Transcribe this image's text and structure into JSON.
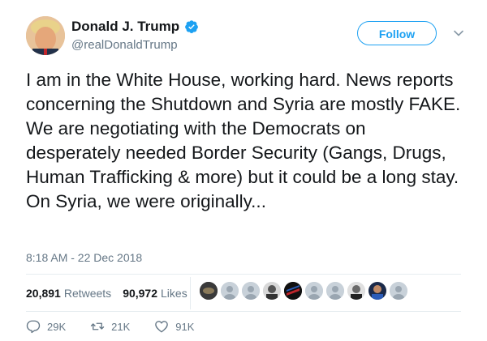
{
  "user": {
    "display_name": "Donald J. Trump",
    "handle": "@realDonaldTrump",
    "verified": true
  },
  "follow_label": "Follow",
  "tweet": {
    "text": "I am in the White House, working hard. News reports concerning the Shutdown and Syria are mostly FAKE. We are negotiating with the Democrats on desperately needed Border Security (Gangs, Drugs, Human Trafficking & more) but it could be a long stay. On Syria, we were originally...",
    "timestamp": "8:18 AM - 22 Dec 2018"
  },
  "stats": {
    "retweets_count": "20,891",
    "retweets_label": "Retweets",
    "likes_count": "90,972",
    "likes_label": "Likes"
  },
  "likers_count": 10,
  "actions": {
    "replies": "29K",
    "retweets": "21K",
    "likes": "91K"
  },
  "colors": {
    "accent": "#1da1f2",
    "text": "#14171a",
    "muted": "#657786",
    "divider": "#e6ecf0"
  }
}
